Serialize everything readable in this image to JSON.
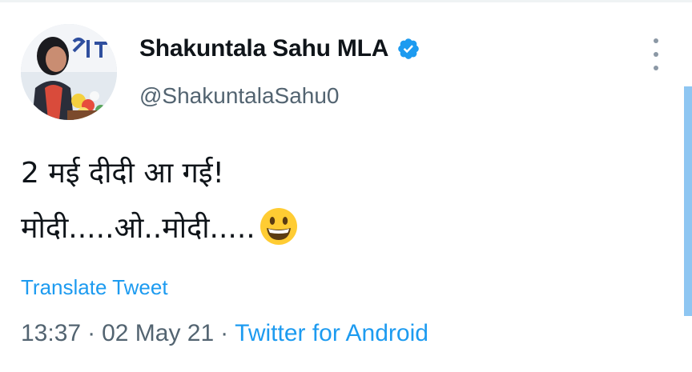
{
  "author": {
    "display_name": "Shakuntala Sahu MLA",
    "handle": "@ShakuntalaSahu0",
    "verified": true
  },
  "tweet": {
    "line1": "2 मई दीदी आ गई!",
    "line2": "मोदी.....ओ..मोदी.....",
    "emoji": "grinning-face-emoji"
  },
  "translate_label": "Translate Tweet",
  "meta": {
    "time": "13:37",
    "separator": "·",
    "date": "02 May 21",
    "source": "Twitter for Android"
  },
  "colors": {
    "link": "#1d9bf0",
    "secondary_text": "#536471",
    "primary_text": "#0f1419",
    "scroll_indicator": "#8ec6f2"
  }
}
